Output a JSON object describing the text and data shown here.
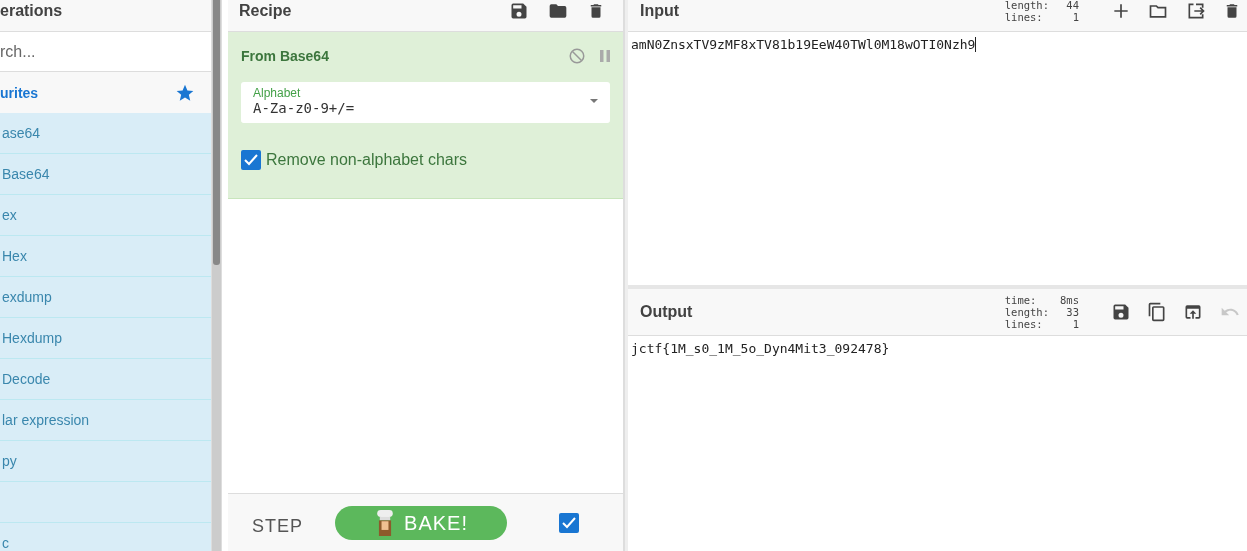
{
  "operations": {
    "title": "erations",
    "search": {
      "placeholder": "rch..."
    },
    "favourites": {
      "label": "urites"
    },
    "items": [
      {
        "kind": "text",
        "label": "ase64"
      },
      {
        "label": "Base64"
      },
      {
        "label": "ex"
      },
      {
        "label": "Hex"
      },
      {
        "label": "exdump"
      },
      {
        "label": "Hexdump"
      },
      {
        "label": "Decode"
      },
      {
        "label": "lar expression"
      },
      {
        "label": "py"
      },
      {
        "kind": "blank"
      },
      {
        "label": "c"
      }
    ]
  },
  "recipe": {
    "title": "Recipe",
    "operations": [
      {
        "name": "From Base64",
        "field": {
          "label": "Alphabet",
          "value": "A-Za-z0-9+/="
        },
        "checkbox": {
          "label": "Remove non-alphabet chars",
          "checked": true
        }
      }
    ],
    "controls": {
      "step": "STEP",
      "bake": "BAKE!",
      "auto_bake": true
    }
  },
  "input": {
    "title": "Input",
    "stats": [
      {
        "label": "length:",
        "value": "44"
      },
      {
        "label": "lines:",
        "value": "1"
      }
    ],
    "text": "amN0ZnsxTV9zMF8xTV81b19EeW40TWl0M18wOTI0Nzh9"
  },
  "output": {
    "title": "Output",
    "stats": [
      {
        "label": "time:",
        "value": "8ms"
      },
      {
        "label": "length:",
        "value": "33"
      },
      {
        "label": "lines:",
        "value": "1"
      }
    ],
    "text": "jctf{1M_s0_1M_5o_Dyn4Mit3_092478}",
    "undo": {
      "disabled": true
    }
  }
}
